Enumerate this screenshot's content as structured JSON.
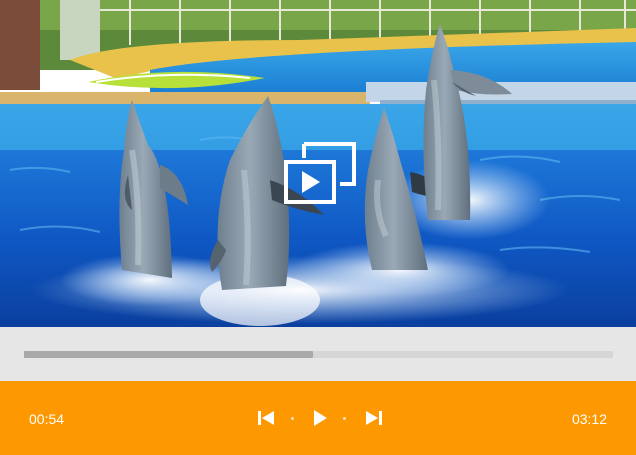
{
  "player": {
    "current_time": "00:54",
    "total_time": "03:12",
    "progress_fraction": 0.49,
    "accent_color": "#fd9800",
    "progress_track_color": "#d6d6d6",
    "progress_fill_color": "#a9a9a9"
  },
  "icons": {
    "cast": "cast-icon",
    "previous": "skip-previous-icon",
    "play": "play-icon",
    "next": "skip-next-icon"
  }
}
